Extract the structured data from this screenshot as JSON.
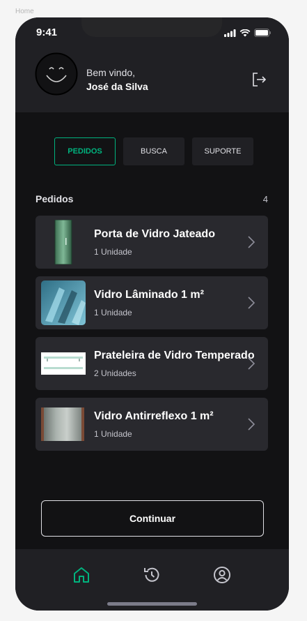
{
  "frame_label": "Home",
  "status_bar": {
    "time": "9:41"
  },
  "header": {
    "greeting": "Bem vindo,",
    "username": "José da Silva",
    "avatar_icon": "smiley-face-icon",
    "logout_icon": "logout-icon"
  },
  "tabs": [
    {
      "label": "PEDIDOS",
      "active": true
    },
    {
      "label": "BUSCA",
      "active": false
    },
    {
      "label": "SUPORTE",
      "active": false
    }
  ],
  "orders_section": {
    "title": "Pedidos",
    "count": "4",
    "items": [
      {
        "name": "Porta de Vidro Jateado",
        "quantity": "1 Unidade"
      },
      {
        "name": "Vidro Lâminado 1 m²",
        "quantity": "1 Unidade"
      },
      {
        "name": "Prateleira de Vidro Temperado",
        "quantity": "2 Unidades"
      },
      {
        "name": "Vidro Antirreflexo 1 m²",
        "quantity": "1 Unidade"
      }
    ]
  },
  "continue_button": {
    "label": "Continuar"
  },
  "bottom_nav": [
    {
      "icon": "home-icon",
      "active": true
    },
    {
      "icon": "history-icon",
      "active": false
    },
    {
      "icon": "profile-icon",
      "active": false
    }
  ],
  "colors": {
    "accent": "#00b37e",
    "background": "#121214",
    "card": "#29292e",
    "header": "#202024"
  }
}
